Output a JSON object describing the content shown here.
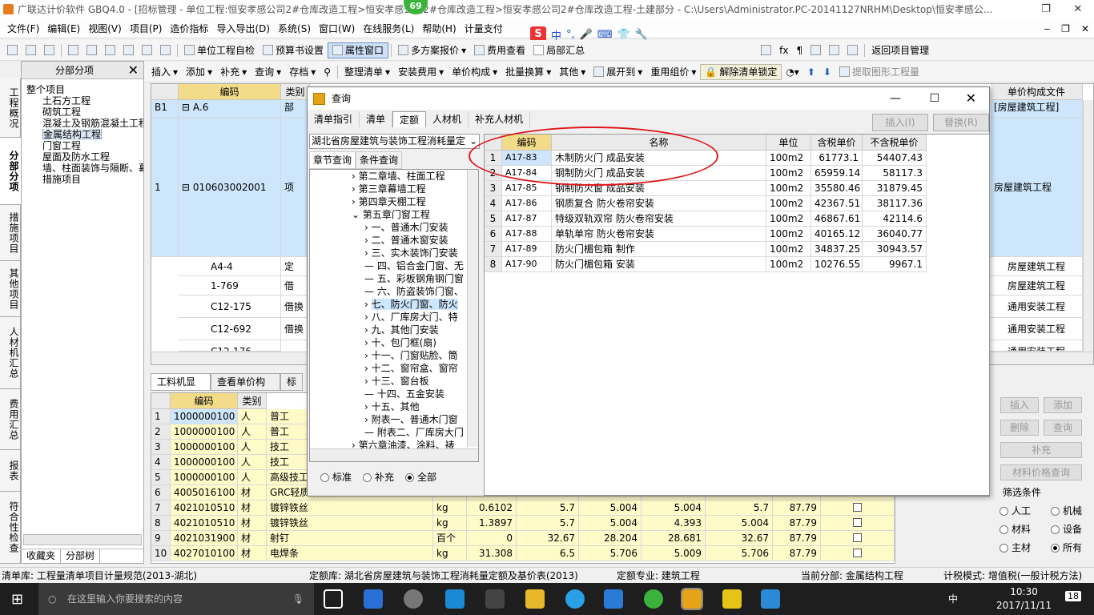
{
  "window": {
    "title": "广联达计价软件 GBQ4.0 - [招标管理 - 单位工程:恒安孝感公司2#仓库改造工程>恒安孝感公司2#仓库改造工程>恒安孝感公司2#仓库改造工程-土建部分 - C:\\Users\\Administrator.PC-20141127NRHM\\Desktop\\恒安孝感公...",
    "badge": "69",
    "restore": "❐",
    "close": "✕"
  },
  "menu": [
    "文件(F)",
    "编辑(E)",
    "视图(V)",
    "项目(P)",
    "造价指标",
    "导入导出(D)",
    "系统(S)",
    "窗口(W)",
    "在线服务(L)",
    "帮助(H)",
    "计量支付"
  ],
  "mdi_controls": [
    "‒",
    "❐",
    "✕"
  ],
  "ime": [
    "中",
    "°,",
    "🎤",
    "⌨",
    "👕",
    "🔧"
  ],
  "toolbar1": {
    "b1": "单位工程自检",
    "b2": "预算书设置",
    "b3": "属性窗口",
    "b4": "多方案报价",
    "b5": "费用查看",
    "b6": "局部汇总",
    "b7": "返回项目管理"
  },
  "toolbar2": {
    "panel": "分部分项",
    "b1": "插入",
    "b2": "添加",
    "b3": "补充",
    "b4": "查询",
    "b5": "存档",
    "b6": "整理清单",
    "b7": "安装费用",
    "b8": "单价构成",
    "b9": "批量换算",
    "b10": "其他",
    "b11": "展开到",
    "b12": "重用组价",
    "b13": "解除清单锁定",
    "b14": "提取图形工程量"
  },
  "left_tabs": [
    "工程概况",
    "分部分项",
    "措施项目",
    "其他项目",
    "人材机汇总",
    "费用汇总",
    "报表",
    "符合性检查"
  ],
  "tree": [
    "整个项目",
    "土石方工程",
    "砌筑工程",
    "混凝土及钢筋混凝土工程",
    "金属结构工程",
    "门窗工程",
    "屋面及防水工程",
    "墙、柱面装饰与隔断、幕",
    "措施项目"
  ],
  "nav_tabs": [
    "收藏夹",
    "分部树"
  ],
  "main_headers": {
    "code": "编码",
    "type": "类别",
    "fee_file": "单价构成文件"
  },
  "main_rows": [
    {
      "no": "B1",
      "code": "A.6",
      "type": "部",
      "file": "[房屋建筑工程]"
    },
    {
      "no": "1",
      "code": "010603002001",
      "type": "项",
      "file": "房屋建筑工程"
    },
    {
      "no": "",
      "code": "A4-4",
      "type": "定",
      "file": "房屋建筑工程"
    },
    {
      "no": "",
      "code": "1-769",
      "type": "借",
      "file": "房屋建筑工程"
    },
    {
      "no": "",
      "code": "C12-175",
      "type": "借换",
      "file": "通用安装工程"
    },
    {
      "no": "",
      "code": "C12-692",
      "type": "借换",
      "file": "通用安装工程"
    },
    {
      "no": "",
      "code": "C12-176",
      "type": "借换",
      "file": "通用安装工程"
    }
  ],
  "lower_tabs": [
    "工料机显示",
    "查看单价构成",
    "标"
  ],
  "low_headers": {
    "code": "编码",
    "type": "类别"
  },
  "low_rows": [
    {
      "no": "1",
      "code": "1000000100",
      "type": "人",
      "name": "普工",
      "unit": "",
      "qty": "",
      "p1": "",
      "p2": "",
      "p3": "",
      "p4": "",
      "p5": "",
      "tax": ""
    },
    {
      "no": "2",
      "code": "1000000100",
      "type": "人",
      "name": "普工",
      "unit": "",
      "qty": "",
      "p1": "",
      "p2": "",
      "p3": "",
      "p4": "",
      "p5": "",
      "tax": ""
    },
    {
      "no": "3",
      "code": "1000000100",
      "type": "人",
      "name": "技工",
      "unit": "",
      "qty": "",
      "p1": "",
      "p2": "",
      "p3": "",
      "p4": "",
      "p5": "",
      "tax": ""
    },
    {
      "no": "4",
      "code": "1000000100",
      "type": "人",
      "name": "技工",
      "unit": "",
      "qty": "",
      "p1": "",
      "p2": "",
      "p3": "",
      "p4": "",
      "p5": "",
      "tax": ""
    },
    {
      "no": "5",
      "code": "1000000100",
      "type": "人",
      "name": "高级技工",
      "unit": "",
      "qty": "",
      "p1": "",
      "p2": "",
      "p3": "",
      "p4": "",
      "p5": "",
      "tax": ""
    },
    {
      "no": "6",
      "code": "4005016100",
      "type": "材",
      "name": "GRC轻质隔墙板",
      "unit": "",
      "qty": "",
      "p1": "",
      "p2": "",
      "p3": "",
      "p4": "",
      "p5": "",
      "tax": ""
    },
    {
      "no": "7",
      "code": "4021010510",
      "type": "材",
      "name": "镀锌铁丝",
      "unit": "kg",
      "qty": "0.6102",
      "p1": "5.7",
      "p2": "5.004",
      "p3": "5.004",
      "p4": "5.7",
      "p5": "",
      "tax": "87.79"
    },
    {
      "no": "8",
      "code": "4021010510",
      "type": "材",
      "name": "镀锌铁丝",
      "unit": "kg",
      "qty": "1.3897",
      "p1": "5.7",
      "p2": "5.004",
      "p3": "4.393",
      "p4": "5.004",
      "p5": "5.7",
      "tax": "87.79"
    },
    {
      "no": "9",
      "code": "4021031900",
      "type": "材",
      "name": "射钉",
      "unit": "百个",
      "qty": "0",
      "p1": "32.67",
      "p2": "28.204",
      "p3": "28.681",
      "p4": "32.67",
      "p5": "",
      "tax": "87.79"
    },
    {
      "no": "10",
      "code": "4027010100",
      "type": "材",
      "name": "电焊条",
      "unit": "kg",
      "qty": "31.308",
      "p1": "6.5",
      "p2": "5.706",
      "p3": "5.009",
      "p4": "5.706",
      "p5": "",
      "tax": "87.79"
    }
  ],
  "right_buttons": [
    "插入",
    "添加",
    "删除",
    "查询",
    "补充",
    "材料价格查询"
  ],
  "filter": {
    "title": "筛选条件",
    "opts": [
      "人工",
      "机械",
      "材料",
      "设备",
      "主材",
      "所有"
    ]
  },
  "dialog": {
    "title": "查询",
    "tabs": [
      "清单指引",
      "清单",
      "定额",
      "人材机",
      "补充人材机"
    ],
    "btn_insert": "插入(I)",
    "btn_replace": "替换(R)",
    "combo": "湖北省房屋建筑与装饰工程消耗量定",
    "sub_tabs": [
      "章节查询",
      "条件查询"
    ],
    "tree": [
      "第二章墙、柱面工程",
      "第三章幕墙工程",
      "第四章天棚工程",
      "第五章门窗工程",
      "一、普通木门安装",
      "二、普通木窗安装",
      "三、实木装饰门安装",
      "四、铝合金门窗、无",
      "五、彩板钢角钢门窗",
      "六、防盗装饰门窗、",
      "七、防火门窗、防火",
      "八、厂库房大门、特",
      "九、其他门安装",
      "十、包门框(扇)",
      "十一、门窗贴脸、筒",
      "十二、窗帘盒、窗帘",
      "十三、窗台板",
      "十四、五金安装",
      "十五、其他",
      "附表一、普通木门窗",
      "附表二、厂库房大门",
      "第六章油漆、涂料、裱"
    ],
    "radios": [
      "标准",
      "补充",
      "全部"
    ],
    "headers": [
      "编码",
      "名称",
      "单位",
      "含税单价",
      "不含税单价"
    ],
    "rows": [
      {
        "no": "1",
        "code": "A17-83",
        "name": "木制防火门 成品安装",
        "unit": "100m2",
        "p1": "61773.1",
        "p2": "54407.43"
      },
      {
        "no": "2",
        "code": "A17-84",
        "name": "钢制防火门 成品安装",
        "unit": "100m2",
        "p1": "65959.14",
        "p2": "58117.3"
      },
      {
        "no": "3",
        "code": "A17-85",
        "name": "钢制防火窗 成品安装",
        "unit": "100m2",
        "p1": "35580.46",
        "p2": "31879.45"
      },
      {
        "no": "4",
        "code": "A17-86",
        "name": "钢质复合 防火卷帘安装",
        "unit": "100m2",
        "p1": "42367.51",
        "p2": "38117.36"
      },
      {
        "no": "5",
        "code": "A17-87",
        "name": "特级双轨双帘 防火卷帘安装",
        "unit": "100m2",
        "p1": "46867.61",
        "p2": "42114.6"
      },
      {
        "no": "6",
        "code": "A17-88",
        "name": "单轨单帘 防火卷帘安装",
        "unit": "100m2",
        "p1": "40165.12",
        "p2": "36040.77"
      },
      {
        "no": "7",
        "code": "A17-89",
        "name": "防火门楣包箱 制作",
        "unit": "100m2",
        "p1": "34837.25",
        "p2": "30943.57"
      },
      {
        "no": "8",
        "code": "A17-90",
        "name": "防火门楣包箱 安装",
        "unit": "100m2",
        "p1": "10276.55",
        "p2": "9967.1"
      }
    ]
  },
  "status": {
    "s1": "清单库: 工程量清单项目计量规范(2013-湖北)",
    "s2": "定额库: 湖北省房屋建筑与装饰工程消耗量定额及基价表(2013)",
    "s3": "定额专业: 建筑工程",
    "s4": "当前分部: 金属结构工程",
    "s5": "计税模式: 增值税(一般计税方法)"
  },
  "taskbar": {
    "search": "在这里输入你要搜索的内容",
    "time": "10:30",
    "date": "2017/11/11",
    "lang": "中",
    "notif": "18"
  },
  "colors": {
    "yellow": "#fffbc8",
    "selblue": "#cde6fb",
    "red": "#e0151a"
  }
}
